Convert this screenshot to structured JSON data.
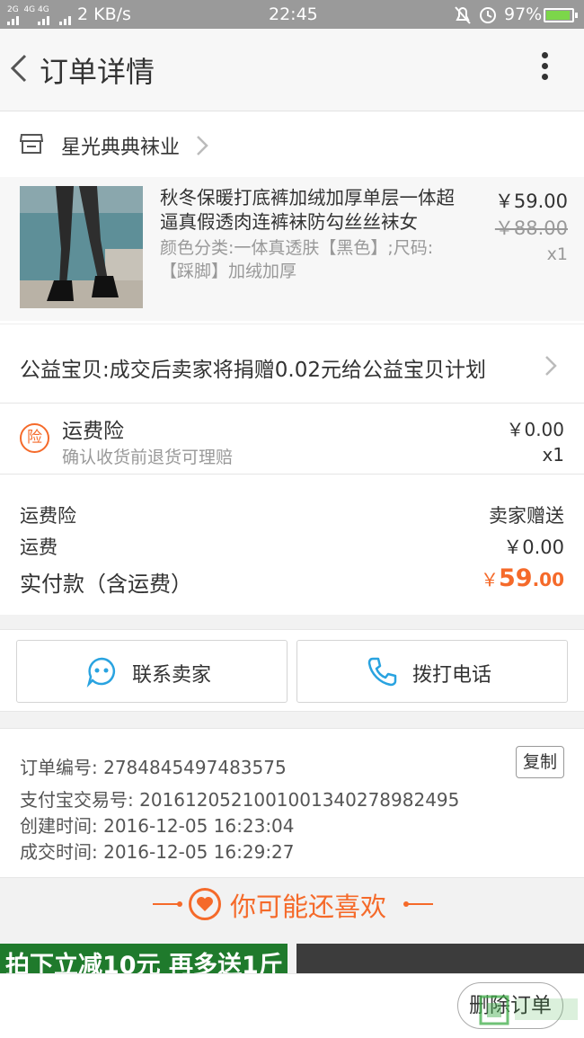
{
  "status_bar": {
    "signal_labels": [
      "2G",
      "4G",
      "4G"
    ],
    "speed": "2 KB/s",
    "time": "22:45",
    "battery": "97%"
  },
  "header": {
    "title": "订单详情"
  },
  "shop": {
    "name": "星光典典袜业"
  },
  "product": {
    "title": "秋冬保暖打底裤加绒加厚单层一体超逼真假透肉连裤袜防勾丝丝袜女",
    "sku": "颜色分类:一体真透肤【黑色】;尺码:【踩脚】加绒加厚",
    "price": "￥59.00",
    "original_price": "￥88.00",
    "quantity": "x1"
  },
  "charity": {
    "text": "公益宝贝:成交后卖家将捐赠0.02元给公益宝贝计划"
  },
  "insurance": {
    "icon_char": "险",
    "title": "运费险",
    "subtitle": "确认收货前退货可理赔",
    "price": "￥0.00",
    "quantity": "x1"
  },
  "summary": {
    "rows": [
      {
        "label": "运费险",
        "value": "卖家赠送"
      },
      {
        "label": "运费",
        "value": "￥0.00"
      }
    ],
    "total_label": "实付款（含运费）",
    "total_currency": "￥",
    "total_int": "59",
    "total_dec": ".00"
  },
  "contact": {
    "seller_label": "联系卖家",
    "phone_label": "拨打电话"
  },
  "order_info": {
    "order_no": "订单编号: 2784845497483575",
    "copy_label": "复制",
    "alipay_no": "支付宝交易号: 2016120521001001340278982495",
    "created": "创建时间: 2016-12-05 16:23:04",
    "completed": "成交时间: 2016-12-05 16:29:27"
  },
  "recommend": {
    "title": "你可能还喜欢",
    "tile1_text": "拍下立减10元 再多送1斤"
  },
  "bottom": {
    "delete_label": "删除订单"
  },
  "colors": {
    "accent": "#f56a2a",
    "contact_icon": "#29a3e0"
  }
}
